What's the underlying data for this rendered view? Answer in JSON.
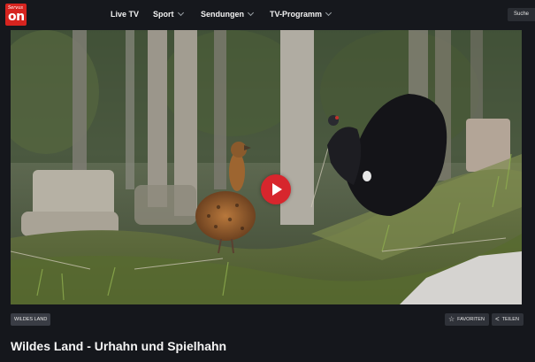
{
  "brand": {
    "logo_small": "Servus",
    "logo_main": "on",
    "accent": "#d6241f"
  },
  "nav": {
    "items": [
      {
        "label": "Live TV",
        "has_dropdown": false
      },
      {
        "label": "Sport",
        "has_dropdown": true
      },
      {
        "label": "Sendungen",
        "has_dropdown": true
      },
      {
        "label": "TV-Programm",
        "has_dropdown": true
      }
    ],
    "search_label": "Suche"
  },
  "player": {
    "play_icon": "play-icon",
    "play_color": "#d7262d"
  },
  "meta": {
    "tag": "WILDES LAND",
    "favorite_label": "FAVORITEN",
    "favorite_icon": "star-icon",
    "share_label": "TEILEN",
    "share_icon": "share-icon"
  },
  "title": "Wildes Land - Urhahn und Spielhahn"
}
